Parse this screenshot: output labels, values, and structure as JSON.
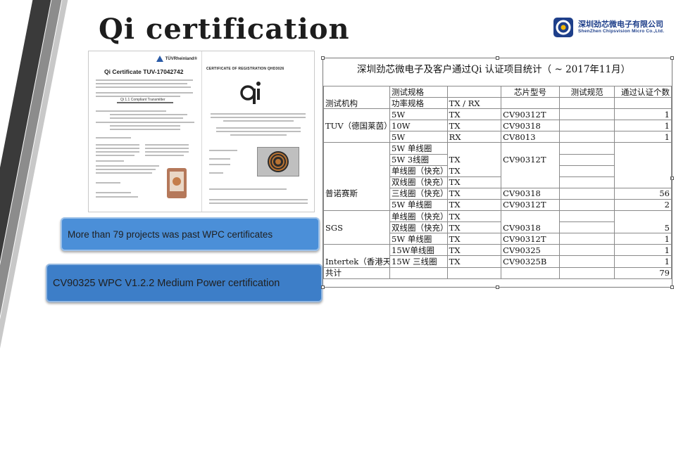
{
  "slide": {
    "title": "Qi  certification",
    "colors": {
      "stripe_dark": "#3a3a3a",
      "stripe_gray": "#8c8c8c",
      "caption_blue": "#4b8fd8",
      "logo_blue": "#1e3f8a"
    }
  },
  "logo": {
    "name_cn": "深圳劲芯微电子有限公司",
    "name_en": "ShenZhen Chipsvision Micro Co.,Ltd.",
    "icon": "chipsvision-logo-icon"
  },
  "certificates": {
    "left": {
      "brand": "TÜVRheinland®",
      "heading": "Qi Certificate TUV-17042742",
      "product": "Qi 1.1 Compliant Transmitter"
    },
    "right": {
      "heading": "CERTIFICATE OF REGISTRATION QHD3026",
      "icon": "qi-logo-icon"
    }
  },
  "captions": {
    "projects": "More than 79 projects was past WPC certificates",
    "medium_power": "CV90325 WPC V1.2.2 Medium Power certification"
  },
  "table": {
    "title": "深圳劲芯微电子及客户通过Qi 认证项目统计（ ~ 2017年11月）",
    "header_row1": [
      "",
      "测试规格",
      "",
      "芯片型号",
      "测试规范",
      "通过认证个数"
    ],
    "header_row2": [
      "测试机构",
      "功率规格",
      "TX / RX",
      "",
      "",
      ""
    ],
    "rows": [
      [
        "",
        "5W",
        "TX",
        "CV90312T",
        "",
        "1"
      ],
      [
        "TUV（德国莱茵）",
        "10W",
        "TX",
        "CV90318",
        "",
        "1"
      ],
      [
        "",
        "5W",
        "RX",
        "CV8013",
        "",
        "1"
      ],
      [
        "",
        "5W 单线圈",
        "",
        "",
        "",
        ""
      ],
      [
        "",
        "5W 3线圈",
        "TX",
        "CV90312T",
        "",
        ""
      ],
      [
        "",
        "单线圈（快充）",
        "TX",
        "",
        "",
        ""
      ],
      [
        "",
        "双线圈（快充）",
        "TX",
        "",
        "",
        ""
      ],
      [
        "普诺赛斯",
        "三线圈（快充）",
        "TX",
        "CV90318",
        "",
        "56"
      ],
      [
        "",
        "5W 单线圈",
        "TX",
        "CV90312T",
        "",
        "2"
      ],
      [
        "",
        "单线圈（快充）",
        "TX",
        "",
        "",
        ""
      ],
      [
        "SGS",
        "双线圈（快充）",
        "TX",
        "CV90318",
        "",
        "5"
      ],
      [
        "",
        "5W 单线圈",
        "TX",
        "CV90312T",
        "",
        "1"
      ],
      [
        "",
        "15W单线圈",
        "TX",
        "CV90325",
        "",
        "1"
      ],
      [
        "Intertek（香港天祥）",
        "15W 三线圈",
        "TX",
        "CV90325B",
        "",
        "1"
      ],
      [
        "共计",
        "",
        "",
        "",
        "",
        "79"
      ]
    ]
  }
}
